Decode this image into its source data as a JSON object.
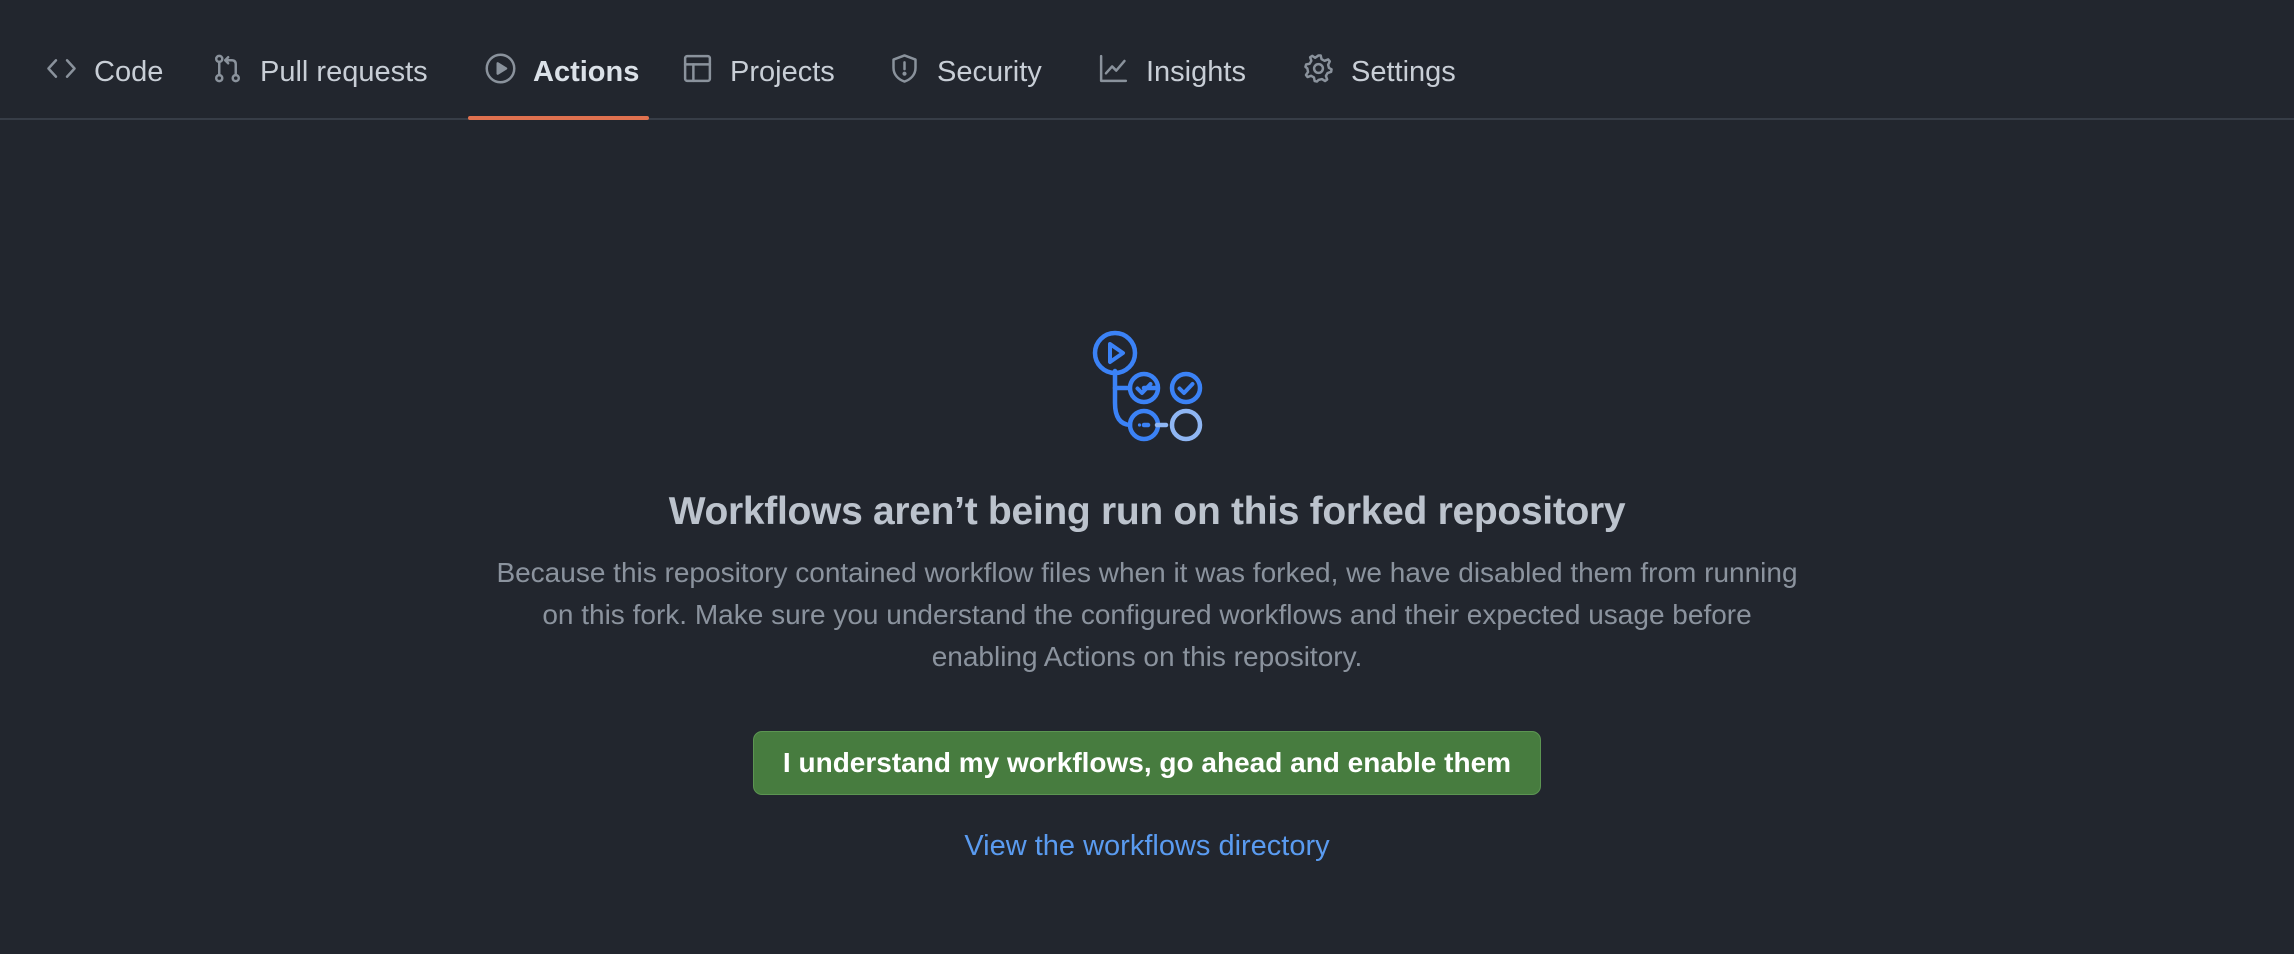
{
  "nav": {
    "tabs": [
      {
        "label": "Code",
        "icon": "code-icon"
      },
      {
        "label": "Pull requests",
        "icon": "git-pull-request-icon"
      },
      {
        "label": "Actions",
        "icon": "play-icon",
        "selected": true
      },
      {
        "label": "Projects",
        "icon": "table-icon"
      },
      {
        "label": "Security",
        "icon": "shield-icon"
      },
      {
        "label": "Insights",
        "icon": "graph-icon"
      },
      {
        "label": "Settings",
        "icon": "gear-icon"
      }
    ],
    "selected_underline_color": "#e0714f"
  },
  "blankslate": {
    "icon": "workflow-icon",
    "title": "Workflows aren’t being run on this forked repository",
    "description_lines": [
      "Because this repository contained workflow files when it was forked, we have disabled them from running",
      "on this fork. Make sure you understand the configured workflows and their expected usage before",
      "enabling Actions on this repository."
    ],
    "enable_button_label": "I understand my workflows, go ahead and enable them",
    "workflows_link_label": "View the workflows directory"
  },
  "colors": {
    "background": "#22262e",
    "accent_blue": "#3b82f6",
    "button_green": "#477c3f",
    "link_blue": "#5a9bf0"
  }
}
